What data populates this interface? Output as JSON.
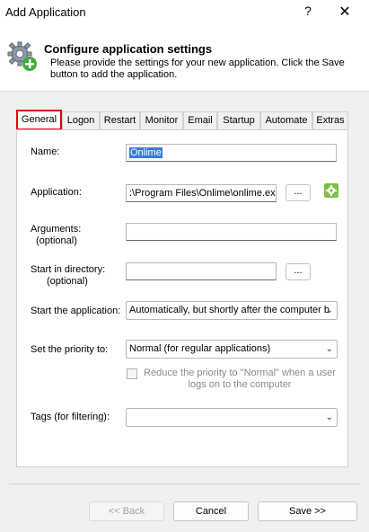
{
  "window": {
    "title": "Add Application",
    "help_glyph": "?",
    "close_glyph": "✕"
  },
  "header": {
    "title": "Configure application settings",
    "description": "Please provide the settings for your new application. Click the Save button to add the application.",
    "icon": "gear-add-icon"
  },
  "tabs": [
    {
      "label": "General",
      "active": true
    },
    {
      "label": "Logon"
    },
    {
      "label": "Restart"
    },
    {
      "label": "Monitor"
    },
    {
      "label": "Email"
    },
    {
      "label": "Startup"
    },
    {
      "label": "Automate"
    },
    {
      "label": "Extras"
    }
  ],
  "form": {
    "name_label": "Name:",
    "name_value": "Onlime",
    "application_label": "Application:",
    "application_value": ":\\Program Files\\Onlime\\onlime.exe",
    "browse_label": "...",
    "arguments_label": "Arguments:",
    "arguments_optional": "(optional)",
    "arguments_value": "",
    "start_dir_label": "Start in directory:",
    "start_dir_optional": "(optional)",
    "start_dir_value": "",
    "start_app_label": "Start the application:",
    "start_app_value": "Automatically, but shortly after the computer b",
    "priority_label": "Set the priority to:",
    "priority_value": "Normal (for regular applications)",
    "reduce_priority_text": "Reduce the priority to \"Normal\" when a user logs on to the computer",
    "tags_label": "Tags (for filtering):",
    "tags_value": ""
  },
  "buttons": {
    "back": "<< Back",
    "cancel": "Cancel",
    "save": "Save >>"
  }
}
